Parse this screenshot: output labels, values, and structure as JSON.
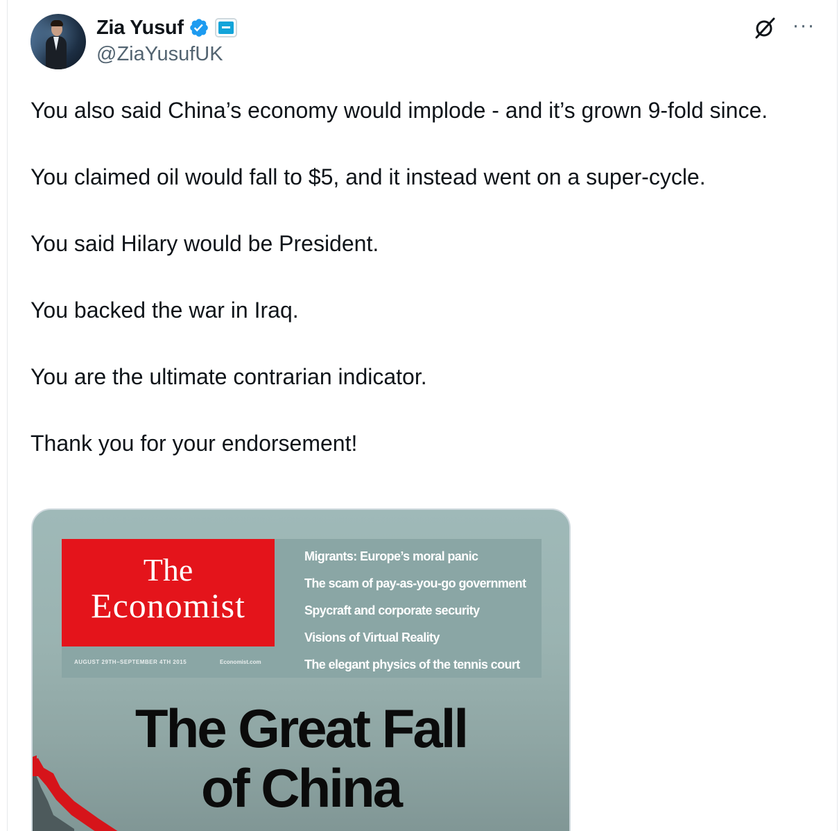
{
  "author": {
    "name": "Zia Yusuf",
    "handle": "@ZiaYusufUK",
    "verified_icon": "verified-badge-icon",
    "affiliation_icon": "affiliate-badge-icon"
  },
  "actions": {
    "grok_icon": "grok-icon",
    "more_icon": "more-options-icon"
  },
  "tweet": {
    "paragraphs": [
      "You also said China’s economy would implode - and it’s grown 9-fold since.",
      "You claimed oil would fall to $5, and it instead went on a super-cycle.",
      "You said Hilary would be President.",
      "You backed the war in Iraq.",
      "You are the ultimate contrarian indicator.",
      "Thank you for your endorsement!"
    ]
  },
  "media": {
    "masthead_the": "The",
    "masthead_economist": "Economist",
    "date_line": "AUGUST 29TH–SEPTEMBER 4TH 2015",
    "site_line": "Economist.com",
    "teasers": [
      "Migrants: Europe’s moral panic",
      "The scam of pay-as-you-go government",
      "Spycraft and corporate security",
      "Visions of Virtual Reality",
      "The elegant physics of the tennis court"
    ],
    "headline_line1": "The Great Fall",
    "headline_line2": "of China"
  },
  "colors": {
    "verified": "#1d9bf0",
    "masthead_red": "#e4141b",
    "handle_gray": "#536471"
  }
}
